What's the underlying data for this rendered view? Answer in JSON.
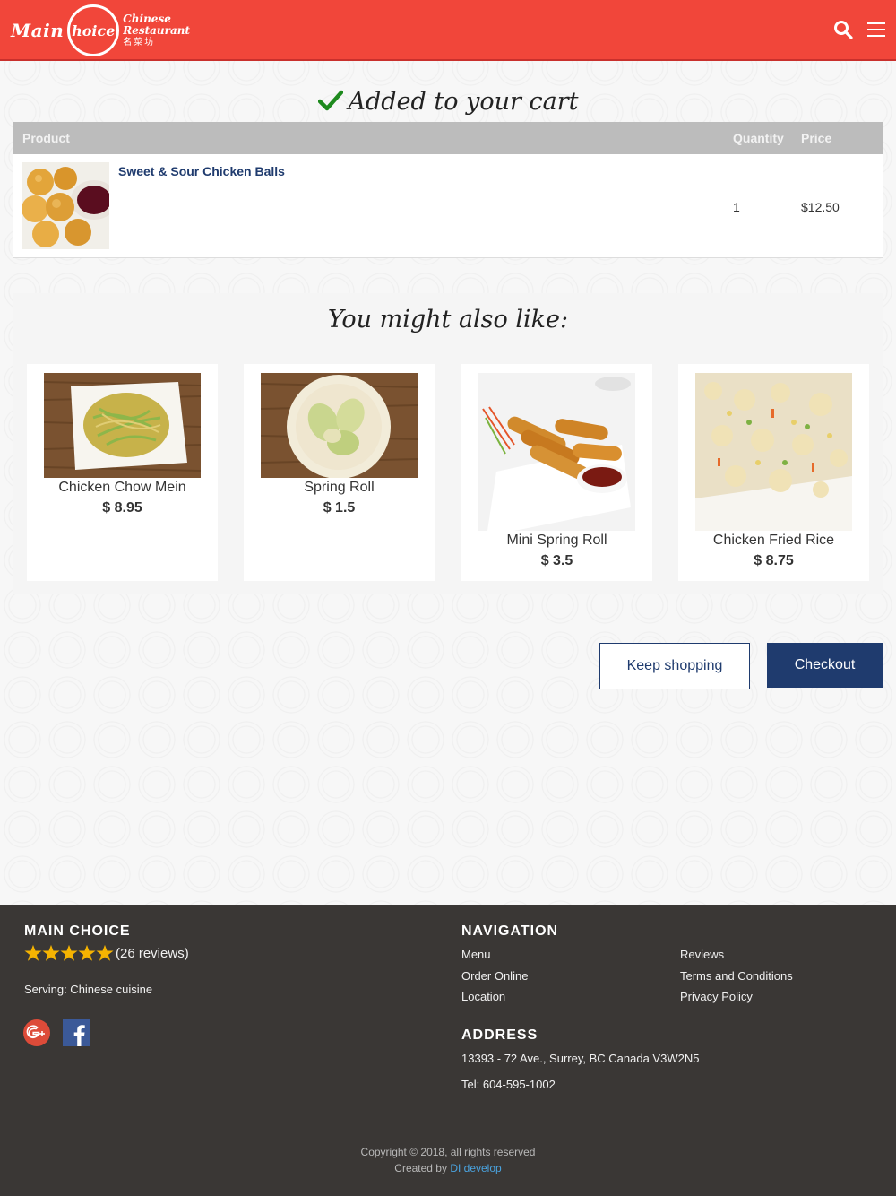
{
  "header": {
    "logo": {
      "main": "Main",
      "circle": "hoice",
      "line1": "Chinese",
      "line2": "Restaurant",
      "line3": "名菜坊"
    },
    "icons": [
      "search-icon",
      "menu-icon"
    ]
  },
  "cart": {
    "heading": "Added to your cart",
    "columns": {
      "product": "Product",
      "quantity": "Quantity",
      "price": "Price"
    },
    "items": [
      {
        "name": "Sweet & Sour Chicken Balls",
        "quantity": "1",
        "price": "$12.50"
      }
    ]
  },
  "recommendations": {
    "title": "You might also like:",
    "items": [
      {
        "name": "Chicken Chow Mein",
        "price": "$ 8.95"
      },
      {
        "name": "Spring Roll",
        "price": "$ 1.5"
      },
      {
        "name": "Mini Spring Roll",
        "price": "$ 3.5"
      },
      {
        "name": "Chicken Fried Rice",
        "price": "$ 8.75"
      }
    ]
  },
  "actions": {
    "keep_shopping": "Keep shopping",
    "checkout": "Checkout"
  },
  "footer": {
    "brand": {
      "title": "MAIN CHOICE",
      "rating_stars": 5,
      "reviews": "(26 reviews)",
      "serving": "Serving: Chinese cuisine"
    },
    "navigation": {
      "title": "NAVIGATION",
      "links": [
        "Menu",
        "Order Online",
        "Location",
        "Reviews",
        "Terms and Conditions",
        "Privacy Policy"
      ]
    },
    "address": {
      "title": "ADDRESS",
      "street": "13393 - 72 Ave., Surrey, BC Canada V3W2N5",
      "tel": "Tel: 604-595-1002"
    },
    "copyright": "Copyright © 2018, all rights reserved",
    "created_by": "Created by",
    "developer": "DI develop"
  },
  "colors": {
    "header": "#f1463a",
    "accent": "#1f3b6e",
    "footer": "#3a3735",
    "star": "#f5b301",
    "check": "#1e8a1e"
  }
}
